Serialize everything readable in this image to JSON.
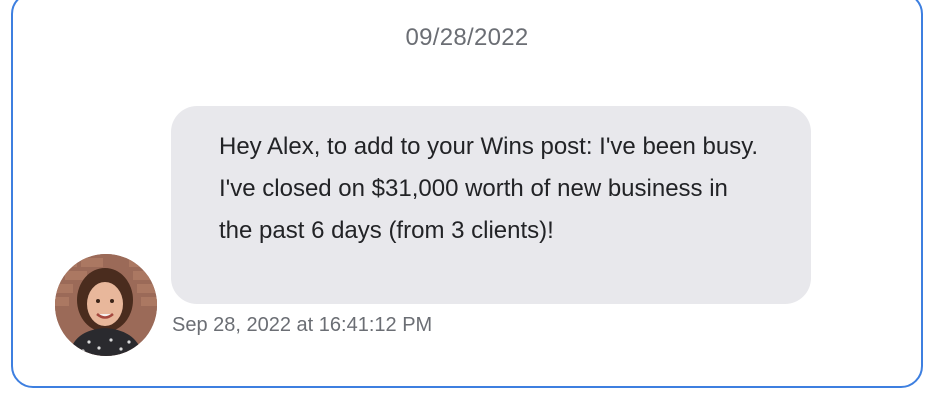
{
  "conversation": {
    "date_header": "09/28/2022",
    "message": {
      "text": "Hey Alex, to add to your Wins post: I've been busy. I've closed on $31,000 worth of new business in the past 6 days (from 3 clients)!",
      "timestamp": "Sep 28, 2022 at 16:41:12 PM",
      "avatar_icon": "user-photo-avatar"
    }
  },
  "colors": {
    "card_border": "#3d7fe0",
    "bubble_bg": "#e8e8ec",
    "muted_text": "#6b6e74",
    "body_text": "#222326"
  }
}
